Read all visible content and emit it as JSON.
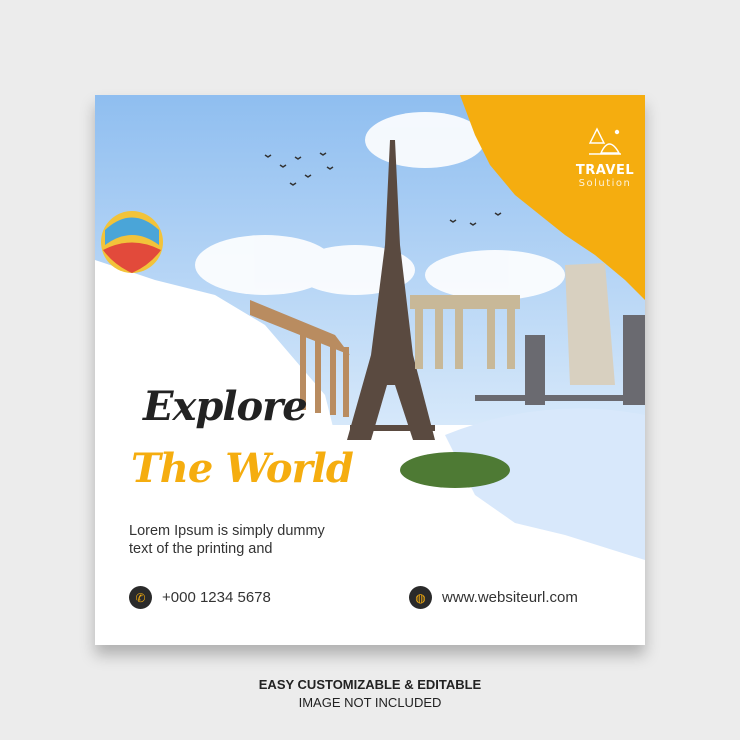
{
  "brand": {
    "title": "TRAVEL",
    "subtitle": "Solution",
    "accent": "#f5ad0f"
  },
  "headline": {
    "line1": "Explore",
    "line2": "The World"
  },
  "description": {
    "line1": "Lorem Ipsum is simply dummy",
    "line2": "text of the printing and"
  },
  "contact": {
    "phone": "+000 1234 5678",
    "phone_icon": "phone-icon",
    "website": "www.websiteurl.com",
    "website_icon": "globe-icon"
  },
  "footer": {
    "line1": "EASY CUSTOMIZABLE & EDITABLE",
    "line2": "IMAGE NOT INCLUDED"
  }
}
